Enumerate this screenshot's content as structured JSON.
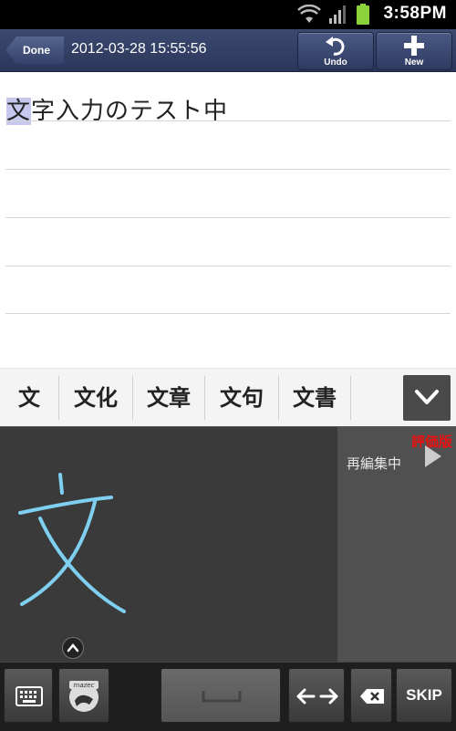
{
  "status_bar": {
    "time": "3:58PM",
    "icons": [
      "wifi-icon",
      "signal-icon",
      "battery-icon"
    ],
    "battery_color": "#8bd13a"
  },
  "action_bar": {
    "done_label": "Done",
    "timestamp": "2012-03-28 15:55:56",
    "undo_label": "Undo",
    "new_label": "New"
  },
  "note": {
    "selected_char": "文",
    "rest_text": "字入力のテスト中"
  },
  "candidates": [
    "文",
    "文化",
    "文章",
    "文句",
    "文書"
  ],
  "handwriting": {
    "stroke_color": "#7fcff0",
    "trial_label": "評価版",
    "reedit_label": "再編集中"
  },
  "keyboard": {
    "skip_label": "SKIP",
    "mazec_logo": "mazec"
  }
}
